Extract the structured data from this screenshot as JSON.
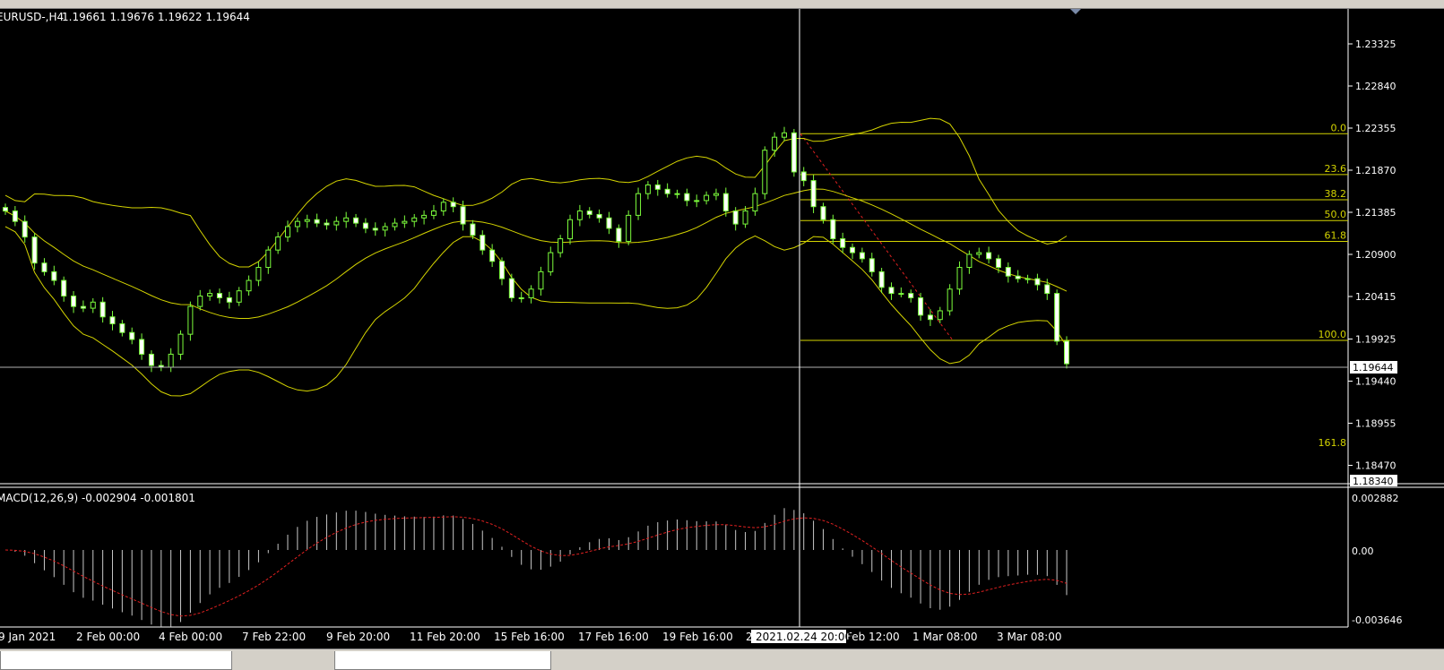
{
  "chart_header": {
    "symbol": "EURUSD-,H4",
    "ohlc": "1.19661 1.19676 1.19622 1.19644"
  },
  "price_axis": {
    "labels": [
      "1.23325",
      "1.22840",
      "1.22355",
      "1.21870",
      "1.21385",
      "1.20900",
      "1.20415",
      "1.19925",
      "1.19440",
      "1.18955",
      "1.18470"
    ],
    "current_price": "1.19644",
    "crosshair_price": "1.18340"
  },
  "time_axis": {
    "labels": [
      "9 Jan 2021",
      "2 Feb 00:00",
      "4 Feb 00:00",
      "7 Feb 22:00",
      "9 Feb 20:00",
      "11 Feb 20:00",
      "15 Feb 16:00",
      "17 Feb 16:00",
      "19 Feb 16:00",
      "2",
      "Feb 12:00",
      "1 Mar 08:00",
      "3 Mar 08:00"
    ],
    "crosshair_time": "2021.02.24 20:00"
  },
  "fibonacci": {
    "levels": [
      "0.0",
      "23.6",
      "38.2",
      "50.0",
      "61.8",
      "100.0",
      "161.8"
    ],
    "prices": [
      1.2229,
      1.2182,
      1.2153,
      1.2129,
      1.2105,
      1.1991,
      1.1866
    ],
    "color": "#d4d400"
  },
  "macd": {
    "title": "MACD(12,26,9) -0.002904 -0.001801",
    "axis_labels": [
      "0.002882",
      "0.00",
      "-0.003646"
    ],
    "signal_color": "#e02020",
    "histogram_color": "#c8c8c8"
  },
  "colors": {
    "background": "#000000",
    "candles": "#7cfc3c",
    "bands": "#d4d400",
    "grid_line": "#ffffff"
  },
  "chart_data": {
    "type": "candlestick",
    "symbol": "EURUSD",
    "timeframe": "H4",
    "last_close": 1.19644,
    "closes": [
      1.214,
      1.2128,
      1.211,
      1.208,
      1.207,
      1.206,
      1.2042,
      1.203,
      1.2028,
      1.2035,
      1.2018,
      1.201,
      1.2,
      1.1992,
      1.1975,
      1.1962,
      1.196,
      1.1975,
      1.1998,
      1.203,
      1.2042,
      1.2045,
      1.204,
      1.2035,
      1.2048,
      1.206,
      1.2075,
      1.2095,
      1.211,
      1.2122,
      1.2128,
      1.213,
      1.2126,
      1.2124,
      1.2128,
      1.2132,
      1.2126,
      1.212,
      1.2118,
      1.2122,
      1.2126,
      1.2128,
      1.2132,
      1.2135,
      1.214,
      1.215,
      1.2145,
      1.2125,
      1.2112,
      1.2095,
      1.2082,
      1.2062,
      1.204,
      1.204,
      1.205,
      1.207,
      1.2092,
      1.2108,
      1.213,
      1.214,
      1.2136,
      1.2132,
      1.212,
      1.2105,
      1.2135,
      1.216,
      1.217,
      1.2165,
      1.216,
      1.216,
      1.2152,
      1.2152,
      1.2158,
      1.216,
      1.214,
      1.2125,
      1.214,
      1.216,
      1.221,
      1.2225,
      1.223,
      1.2185,
      1.2175,
      1.2145,
      1.213,
      1.2108,
      1.2098,
      1.2092,
      1.2085,
      1.207,
      1.2052,
      1.2045,
      1.2045,
      1.204,
      1.202,
      1.2015,
      1.2025,
      1.205,
      1.2075,
      1.209,
      1.2092,
      1.2085,
      1.2075,
      1.2065,
      1.2062,
      1.2062,
      1.2055,
      1.2045,
      1.199,
      1.1964
    ]
  }
}
